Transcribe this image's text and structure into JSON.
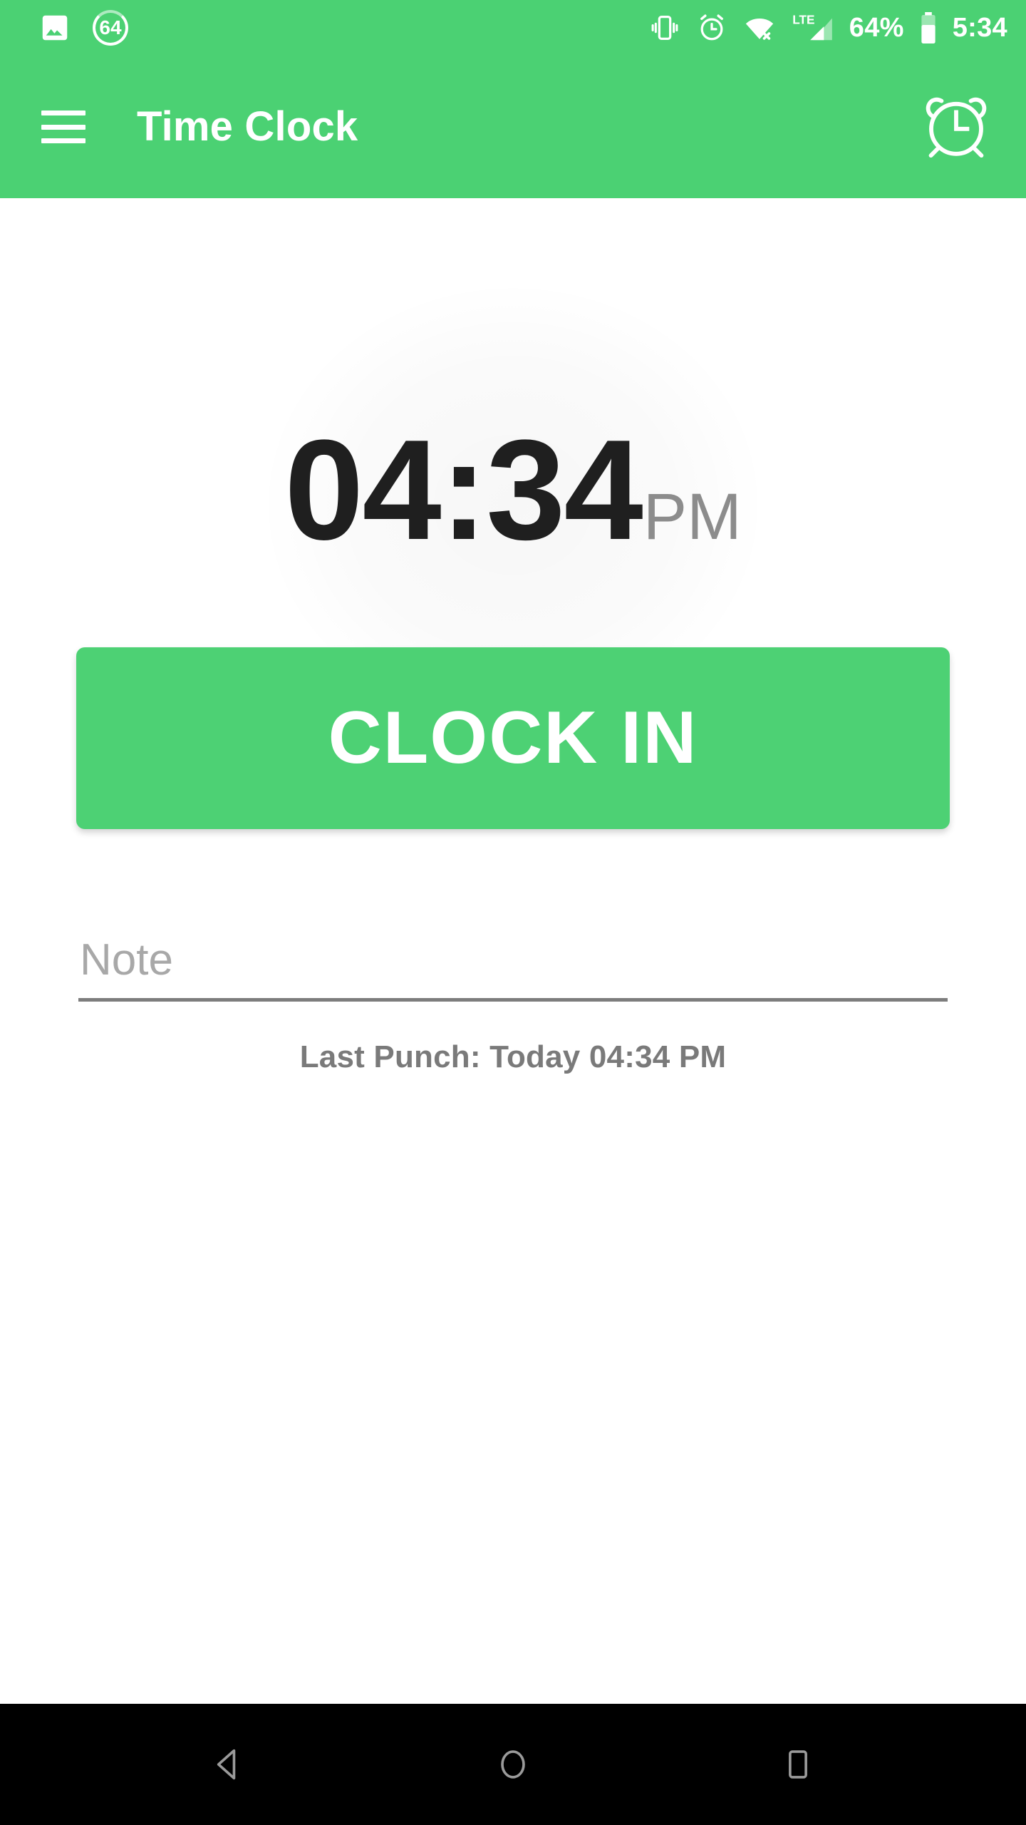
{
  "colors": {
    "brand_green": "#4BD173",
    "button_green": "#4DD174",
    "time_text": "#1f1f1f",
    "ampm_text": "#8c8c8c",
    "muted_text": "#7a7a7a",
    "placeholder": "#a8a8a8",
    "nav_bar_bg": "#000000",
    "nav_icon": "#9a9a9a"
  },
  "status_bar": {
    "left_icons": [
      {
        "name": "photo-icon",
        "label": "Screenshot"
      },
      {
        "name": "download-progress-icon",
        "label": "64"
      }
    ],
    "download_progress": "64",
    "right_icons": [
      {
        "name": "vibrate-icon",
        "label": "Vibrate"
      },
      {
        "name": "alarm-set-icon",
        "label": "Alarm set"
      },
      {
        "name": "wifi-off-icon",
        "label": "Wi-Fi disconnected"
      },
      {
        "name": "lte-signal-icon",
        "label": "LTE"
      }
    ],
    "network_type": "LTE",
    "battery_percent": "64%",
    "clock": "5:34"
  },
  "app_bar": {
    "menu_icon": "hamburger-menu-icon",
    "title": "Time Clock",
    "action_icon": "alarm-clock-icon"
  },
  "main": {
    "time": "04:34",
    "meridiem": "PM",
    "clock_button_label": "CLOCK IN",
    "note": {
      "value": "",
      "placeholder": "Note"
    },
    "last_punch": "Last Punch: Today 04:34 PM"
  },
  "nav_bar": {
    "buttons": [
      {
        "name": "back-button",
        "label": "Back"
      },
      {
        "name": "home-button",
        "label": "Home"
      },
      {
        "name": "recents-button",
        "label": "Recents"
      }
    ]
  }
}
